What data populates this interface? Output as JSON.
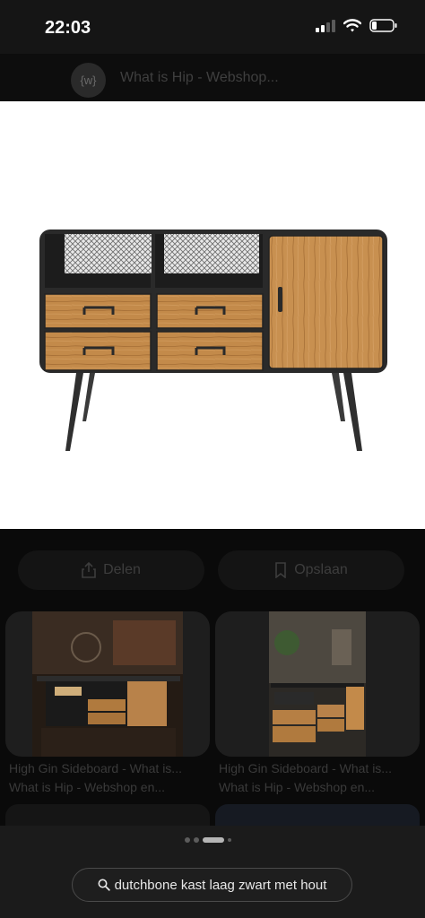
{
  "status_bar": {
    "time": "22:03"
  },
  "source": {
    "logo_text": "{w}",
    "title": "What is Hip - Webshop..."
  },
  "actions": {
    "share_label": "Delen",
    "save_label": "Opslaan"
  },
  "related": [
    {
      "title": "High Gin Sideboard - What is...",
      "source": "What is Hip - Webshop en..."
    },
    {
      "title": "High Gin Sideboard - What is...",
      "source": "What is Hip - Webshop en..."
    }
  ],
  "pagination": {
    "count": 4,
    "active_index": 2
  },
  "search": {
    "query": "dutchbone kast laag zwart met hout"
  },
  "colors": {
    "background": "#0a0a0a",
    "wood": "#c38a4a",
    "metal": "#2b2b2b"
  },
  "icons": [
    "signal-icon",
    "wifi-icon",
    "battery-icon",
    "share-icon",
    "bookmark-icon",
    "search-icon"
  ]
}
